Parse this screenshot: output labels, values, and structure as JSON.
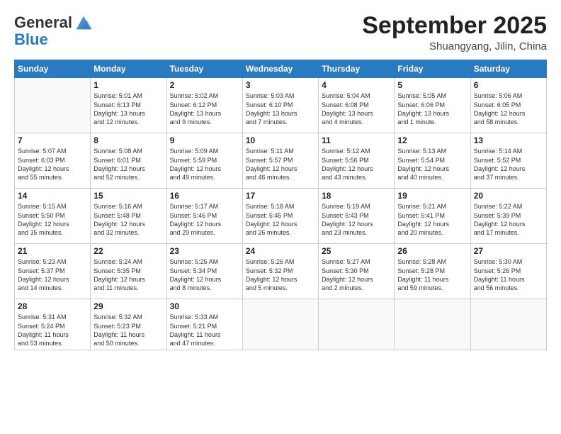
{
  "header": {
    "logo_general": "General",
    "logo_blue": "Blue",
    "month_title": "September 2025",
    "location": "Shuangyang, Jilin, China"
  },
  "columns": [
    "Sunday",
    "Monday",
    "Tuesday",
    "Wednesday",
    "Thursday",
    "Friday",
    "Saturday"
  ],
  "weeks": [
    [
      {
        "day": "",
        "info": ""
      },
      {
        "day": "1",
        "info": "Sunrise: 5:01 AM\nSunset: 6:13 PM\nDaylight: 13 hours\nand 12 minutes."
      },
      {
        "day": "2",
        "info": "Sunrise: 5:02 AM\nSunset: 6:12 PM\nDaylight: 13 hours\nand 9 minutes."
      },
      {
        "day": "3",
        "info": "Sunrise: 5:03 AM\nSunset: 6:10 PM\nDaylight: 13 hours\nand 7 minutes."
      },
      {
        "day": "4",
        "info": "Sunrise: 5:04 AM\nSunset: 6:08 PM\nDaylight: 13 hours\nand 4 minutes."
      },
      {
        "day": "5",
        "info": "Sunrise: 5:05 AM\nSunset: 6:06 PM\nDaylight: 13 hours\nand 1 minute."
      },
      {
        "day": "6",
        "info": "Sunrise: 5:06 AM\nSunset: 6:05 PM\nDaylight: 12 hours\nand 58 minutes."
      }
    ],
    [
      {
        "day": "7",
        "info": "Sunrise: 5:07 AM\nSunset: 6:03 PM\nDaylight: 12 hours\nand 55 minutes."
      },
      {
        "day": "8",
        "info": "Sunrise: 5:08 AM\nSunset: 6:01 PM\nDaylight: 12 hours\nand 52 minutes."
      },
      {
        "day": "9",
        "info": "Sunrise: 5:09 AM\nSunset: 5:59 PM\nDaylight: 12 hours\nand 49 minutes."
      },
      {
        "day": "10",
        "info": "Sunrise: 5:11 AM\nSunset: 5:57 PM\nDaylight: 12 hours\nand 46 minutes."
      },
      {
        "day": "11",
        "info": "Sunrise: 5:12 AM\nSunset: 5:56 PM\nDaylight: 12 hours\nand 43 minutes."
      },
      {
        "day": "12",
        "info": "Sunrise: 5:13 AM\nSunset: 5:54 PM\nDaylight: 12 hours\nand 40 minutes."
      },
      {
        "day": "13",
        "info": "Sunrise: 5:14 AM\nSunset: 5:52 PM\nDaylight: 12 hours\nand 37 minutes."
      }
    ],
    [
      {
        "day": "14",
        "info": "Sunrise: 5:15 AM\nSunset: 5:50 PM\nDaylight: 12 hours\nand 35 minutes."
      },
      {
        "day": "15",
        "info": "Sunrise: 5:16 AM\nSunset: 5:48 PM\nDaylight: 12 hours\nand 32 minutes."
      },
      {
        "day": "16",
        "info": "Sunrise: 5:17 AM\nSunset: 5:46 PM\nDaylight: 12 hours\nand 29 minutes."
      },
      {
        "day": "17",
        "info": "Sunrise: 5:18 AM\nSunset: 5:45 PM\nDaylight: 12 hours\nand 26 minutes."
      },
      {
        "day": "18",
        "info": "Sunrise: 5:19 AM\nSunset: 5:43 PM\nDaylight: 12 hours\nand 23 minutes."
      },
      {
        "day": "19",
        "info": "Sunrise: 5:21 AM\nSunset: 5:41 PM\nDaylight: 12 hours\nand 20 minutes."
      },
      {
        "day": "20",
        "info": "Sunrise: 5:22 AM\nSunset: 5:39 PM\nDaylight: 12 hours\nand 17 minutes."
      }
    ],
    [
      {
        "day": "21",
        "info": "Sunrise: 5:23 AM\nSunset: 5:37 PM\nDaylight: 12 hours\nand 14 minutes."
      },
      {
        "day": "22",
        "info": "Sunrise: 5:24 AM\nSunset: 5:35 PM\nDaylight: 12 hours\nand 11 minutes."
      },
      {
        "day": "23",
        "info": "Sunrise: 5:25 AM\nSunset: 5:34 PM\nDaylight: 12 hours\nand 8 minutes."
      },
      {
        "day": "24",
        "info": "Sunrise: 5:26 AM\nSunset: 5:32 PM\nDaylight: 12 hours\nand 5 minutes."
      },
      {
        "day": "25",
        "info": "Sunrise: 5:27 AM\nSunset: 5:30 PM\nDaylight: 12 hours\nand 2 minutes."
      },
      {
        "day": "26",
        "info": "Sunrise: 5:28 AM\nSunset: 5:28 PM\nDaylight: 11 hours\nand 59 minutes."
      },
      {
        "day": "27",
        "info": "Sunrise: 5:30 AM\nSunset: 5:26 PM\nDaylight: 11 hours\nand 56 minutes."
      }
    ],
    [
      {
        "day": "28",
        "info": "Sunrise: 5:31 AM\nSunset: 5:24 PM\nDaylight: 11 hours\nand 53 minutes."
      },
      {
        "day": "29",
        "info": "Sunrise: 5:32 AM\nSunset: 5:23 PM\nDaylight: 11 hours\nand 50 minutes."
      },
      {
        "day": "30",
        "info": "Sunrise: 5:33 AM\nSunset: 5:21 PM\nDaylight: 11 hours\nand 47 minutes."
      },
      {
        "day": "",
        "info": ""
      },
      {
        "day": "",
        "info": ""
      },
      {
        "day": "",
        "info": ""
      },
      {
        "day": "",
        "info": ""
      }
    ]
  ]
}
